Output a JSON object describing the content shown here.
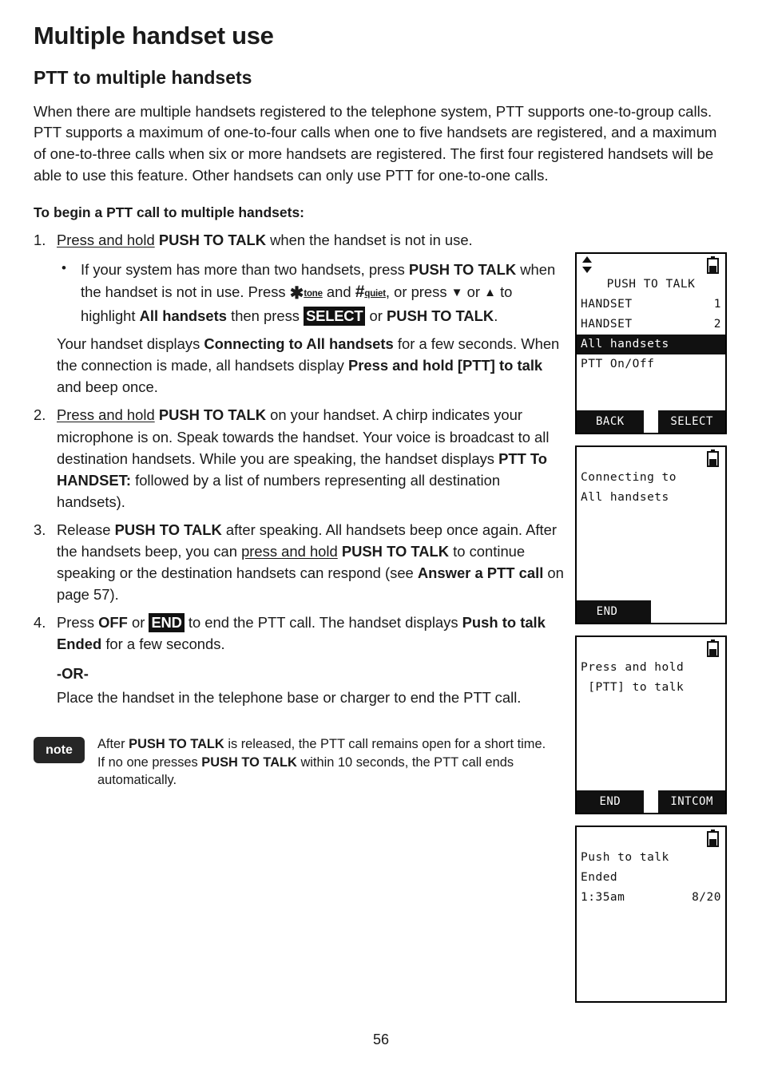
{
  "document": {
    "chapter_title": "Multiple handset use",
    "section_title": "PTT to multiple handsets",
    "intro_paragraph": "When there are multiple handsets registered to the telephone system, PTT supports one-to-group calls. PTT supports a maximum of one-to-four calls when one to five handsets are registered, and a maximum of one-to-three calls when six or more handsets are registered. The first four registered handsets will be able to use this feature. Other handsets can only use PTT for one-to-one calls.",
    "lead_in": "To begin a PTT call to multiple handsets:",
    "page_number": "56"
  },
  "steps": {
    "step1": {
      "number": "1.",
      "part_underline": "Press and hold",
      "part_bold": "PUSH TO TALK",
      "part_tail": " when the handset is not in use.",
      "bullet": {
        "a": "If your system has more than two handsets, press ",
        "b_bold": "PUSH TO TALK",
        "c": " when the handset is not in use. Press ",
        "star_key": "✱",
        "star_sub": "tone",
        "d": " and ",
        "hash_key": "#",
        "hash_sub": "quiet",
        "e": ", or press ",
        "down_arrow": "▼",
        "f": " or ",
        "up_arrow": "▲",
        "g": " to highlight ",
        "h_bold": "All handsets",
        "i": " then press ",
        "select_badge": "SELECT",
        "j": " or ",
        "k_bold": "PUSH TO TALK",
        "l": "."
      },
      "sub_paragraph": {
        "a": "Your handset displays ",
        "b_bold": "Connecting to All handsets",
        "c": " for a few seconds. When the connection is made, all handsets display ",
        "d_bold": "Press and hold [PTT] to talk",
        "e": " and beep once."
      }
    },
    "step2": {
      "number": "2.",
      "part_underline": "Press and hold",
      "part_bold": "PUSH TO TALK",
      "mid": " on your handset. A chirp indicates your microphone is on. Speak towards the handset. Your voice is broadcast to all destination handsets. While you are speaking, the handset displays ",
      "bold2": "PTT To HANDSET:",
      "tail": " followed by a list of numbers representing all destination handsets)."
    },
    "step3": {
      "number": "3.",
      "a": "Release ",
      "b_bold": "PUSH TO TALK",
      "c": " after speaking. All handsets beep once again. After the handsets beep, you can ",
      "d_underline": "press and hold",
      "e": " ",
      "f_bold": "PUSH TO TALK",
      "g": " to continue speaking or the destination handsets can respond (see ",
      "h_bold": "Answer a PTT call",
      "i": " on page 57)."
    },
    "step4": {
      "number": "4.",
      "a": "Press ",
      "b_bold": "OFF",
      "c": " or ",
      "end_badge": "END",
      "d": " to end the PTT call. The handset displays ",
      "e_bold": "Push to talk Ended",
      "f": " for a few seconds.",
      "or_label": "-OR-",
      "or_body": "Place the handset in the telephone base or charger to end the PTT call."
    }
  },
  "note": {
    "badge_label": "note",
    "a": "After ",
    "b_bold": "PUSH TO TALK",
    "c": " is released, the PTT call remains open for a short time. If no one presses ",
    "d_bold": "PUSH TO TALK",
    "e": " within 10 seconds, the PTT call ends automatically."
  },
  "lcd_screens": [
    {
      "id": "ptt-menu-screen",
      "status": {
        "scroll_icon": "up-down-arrows-icon",
        "battery_icon": "battery-half-icon"
      },
      "title": "PUSH TO TALK",
      "rows": [
        {
          "label": "HANDSET",
          "value": "1",
          "highlighted": false
        },
        {
          "label": "HANDSET",
          "value": "2",
          "highlighted": false
        },
        {
          "label": "All handsets",
          "value": "",
          "highlighted": true
        },
        {
          "label": "PTT On/Off",
          "value": "",
          "highlighted": false
        }
      ],
      "softkey_left": "BACK",
      "softkey_right": "SELECT"
    },
    {
      "id": "connecting-screen",
      "status": {
        "battery_icon": "battery-half-icon"
      },
      "lines": [
        "Connecting to",
        "All handsets"
      ],
      "softkey_left": "END",
      "softkey_right": ""
    },
    {
      "id": "press-and-hold-screen",
      "status": {
        "battery_icon": "battery-half-icon"
      },
      "lines": [
        "Press and hold",
        " [PTT] to talk"
      ],
      "softkey_left": "END",
      "softkey_right": "INTCOM"
    },
    {
      "id": "ptt-ended-screen",
      "status": {
        "battery_icon": "battery-half-icon"
      },
      "lines": [
        "Push to talk",
        "Ended"
      ],
      "time": "1:35am",
      "date": "8/20",
      "softkey_left": "",
      "softkey_right": ""
    }
  ],
  "colors": {
    "ink": "#1a1a1a",
    "lcd_black": "#111111",
    "note_badge": "#262626"
  }
}
